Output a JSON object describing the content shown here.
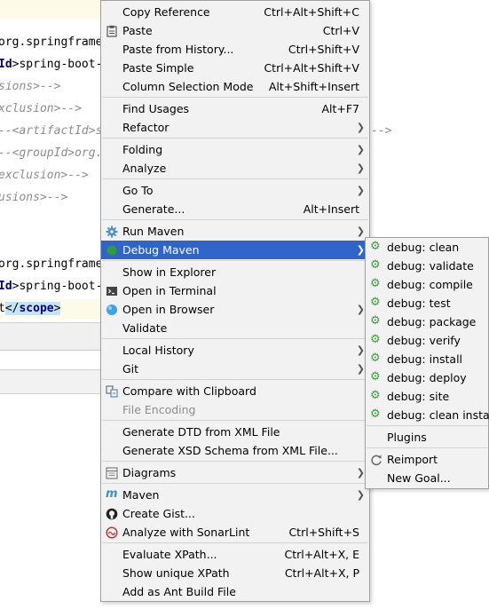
{
  "editor": {
    "lines": [
      {
        "text": "org.springframe"
      },
      {
        "parts": [
          "Id",
          "spring-boot-"
        ]
      },
      {
        "comment": "sions>-->"
      },
      {
        "comment": "xclusion>-->"
      },
      {
        "comment": "--<artifactId>s"
      },
      {
        "comment": "--<groupId>org."
      },
      {
        "comment": "exclusion>-->"
      },
      {
        "comment": "usions>-->"
      },
      {
        "text": "org.springframe"
      },
      {
        "parts": [
          "Id",
          "spring-boot-"
        ]
      },
      {
        "parts": [
          "t",
          "scope"
        ]
      }
    ],
    "trailing_comment": "-->"
  },
  "context_menu": {
    "items": [
      {
        "label": "Copy Reference",
        "shortcut": "Ctrl+Alt+Shift+C"
      },
      {
        "label": "Paste",
        "shortcut": "Ctrl+V",
        "icon": "clipboard-icon"
      },
      {
        "label": "Paste from History...",
        "shortcut": "Ctrl+Shift+V"
      },
      {
        "label": "Paste Simple",
        "shortcut": "Ctrl+Alt+Shift+V"
      },
      {
        "label": "Column Selection Mode",
        "shortcut": "Alt+Shift+Insert"
      },
      {
        "label": "Find Usages",
        "shortcut": "Alt+F7"
      },
      {
        "label": "Refactor",
        "submenu": true
      },
      {
        "label": "Folding",
        "submenu": true
      },
      {
        "label": "Analyze",
        "submenu": true
      },
      {
        "label": "Go To",
        "submenu": true
      },
      {
        "label": "Generate...",
        "shortcut": "Alt+Insert"
      },
      {
        "label": "Run Maven",
        "submenu": true,
        "icon": "gear-icon"
      },
      {
        "label": "Debug Maven",
        "submenu": true,
        "icon": "debug-icon",
        "selected": true
      },
      {
        "label": "Show in Explorer"
      },
      {
        "label": "Open in Terminal",
        "icon": "terminal-icon"
      },
      {
        "label": "Open in Browser",
        "submenu": true,
        "icon": "globe-icon"
      },
      {
        "label": "Validate"
      },
      {
        "label": "Local History",
        "submenu": true
      },
      {
        "label": "Git",
        "submenu": true
      },
      {
        "label": "Compare with Clipboard",
        "icon": "compare-icon"
      },
      {
        "label": "File Encoding",
        "disabled": true
      },
      {
        "label": "Generate DTD from XML File"
      },
      {
        "label": "Generate XSD Schema from XML File..."
      },
      {
        "label": "Diagrams",
        "submenu": true,
        "icon": "diagram-icon"
      },
      {
        "label": "Maven",
        "submenu": true,
        "icon": "maven-icon"
      },
      {
        "label": "Create Gist...",
        "icon": "github-icon"
      },
      {
        "label": "Analyze with SonarLint",
        "shortcut": "Ctrl+Shift+S",
        "icon": "sonarlint-icon"
      },
      {
        "label": "Evaluate XPath...",
        "shortcut": "Ctrl+Alt+X, E"
      },
      {
        "label": "Show unique XPath",
        "shortcut": "Ctrl+Alt+X, P"
      },
      {
        "label": "Add as Ant Build File"
      }
    ]
  },
  "debug_submenu": {
    "items": [
      {
        "label": "debug: clean"
      },
      {
        "label": "debug: validate"
      },
      {
        "label": "debug: compile"
      },
      {
        "label": "debug: test"
      },
      {
        "label": "debug: package"
      },
      {
        "label": "debug: verify"
      },
      {
        "label": "debug: install"
      },
      {
        "label": "debug: deploy"
      },
      {
        "label": "debug: site"
      },
      {
        "label": "debug: clean install"
      },
      {
        "label": "Plugins"
      },
      {
        "label": "Reimport",
        "icon": "refresh-icon"
      },
      {
        "label": "New Goal..."
      }
    ]
  },
  "colors": {
    "menu_bg": "#f2f2f2",
    "selection": "#2f65ca",
    "goal_icon": "#3e9b3e",
    "xml_tag": "#000080",
    "comment": "#8c8c8c"
  }
}
